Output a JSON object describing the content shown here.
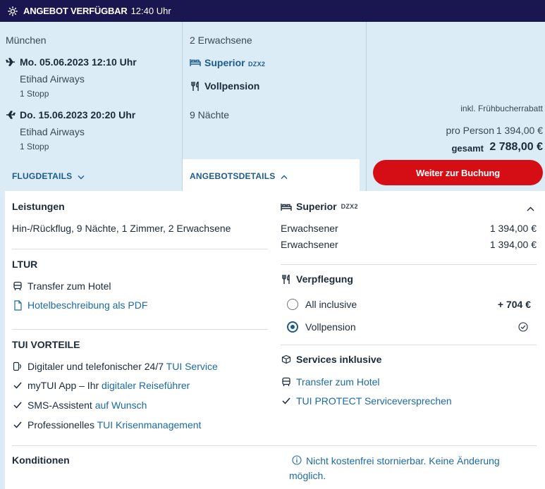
{
  "topbar": {
    "title": "ANGEBOT VERFÜGBAR",
    "time": "12:40 Uhr"
  },
  "flight": {
    "origin": "München",
    "outbound": {
      "date": "Mo. 05.06.2023 12:10 Uhr",
      "airline": "Etihad Airways",
      "stops": "1 Stopp"
    },
    "return": {
      "date": "Do. 15.06.2023 20:20 Uhr",
      "airline": "Etihad Airways",
      "stops": "1 Stopp"
    },
    "details_link": "FLUGDETAILS"
  },
  "offer": {
    "travellers": "2 Erwachsene",
    "room": "Superior",
    "room_code": "DZX2",
    "board": "Vollpension",
    "nights": "9 Nächte",
    "details_tab": "ANGEBOTSDETAILS"
  },
  "price": {
    "discount_note": "inkl. Frühbucherrabatt",
    "per_person_label": "pro Person",
    "per_person_value": "1 394,00 €",
    "total_label": "gesamt",
    "total_value": "2 788,00 €",
    "book_button": "Weiter zur Buchung"
  },
  "details": {
    "leistungen": {
      "heading": "Leistungen",
      "text": "Hin-/Rückflug, 9 Nächte, 1 Zimmer, 2 Erwachsene"
    },
    "ltur": {
      "heading": "LTUR",
      "transfer": "Transfer zum Hotel",
      "pdf": "Hotelbeschreibung als PDF"
    },
    "tui": {
      "heading": "TUI VORTEILE",
      "items": [
        {
          "plain": "Digitaler und telefonischer 24/7 ",
          "link": "TUI Service"
        },
        {
          "plain": "myTUI App – Ihr ",
          "link": "digitaler Reiseführer"
        },
        {
          "plain": "SMS-Assistent ",
          "link": "auf Wunsch"
        },
        {
          "plain": "Professionelles ",
          "link": "TUI Krisenmanagement"
        }
      ]
    },
    "konditionen": {
      "heading": "Konditionen",
      "note": "Nicht kostenfrei stornierbar. Keine Änderung möglich."
    },
    "room_box": {
      "title": "Superior",
      "code": "DZX2",
      "rows": [
        {
          "label": "Erwachsener",
          "value": "1 394,00 €"
        },
        {
          "label": "Erwachsener",
          "value": "1 394,00 €"
        }
      ]
    },
    "board": {
      "heading": "Verpflegung",
      "options": [
        {
          "label": "All inclusive",
          "price": "+ 704 €",
          "selected": false
        },
        {
          "label": "Vollpension",
          "price": "",
          "selected": true
        }
      ]
    },
    "services": {
      "heading": "Services inklusive",
      "items": [
        "Transfer zum Hotel",
        "TUI PROTECT Serviceversprechen"
      ]
    }
  },
  "colors": {
    "navy": "#1a1650",
    "red": "#d40e14",
    "light_blue": "#dcecf7",
    "link": "#1b6aa5"
  }
}
